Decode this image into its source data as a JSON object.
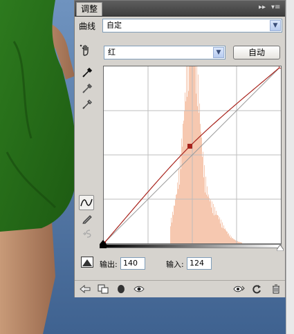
{
  "panel": {
    "tab_label": "调整",
    "menu_glyph": "▸▸|▾≡"
  },
  "curves": {
    "preset_label": "曲线",
    "preset_value": "自定",
    "channel_value": "红",
    "auto_button": "自动"
  },
  "io": {
    "output_label": "输出:",
    "output_value": "140",
    "input_label": "输入:",
    "input_value": "124"
  },
  "icons": {
    "hand": "hand-adjust-icon",
    "black_eyedropper": "eyedropper-black-icon",
    "gray_eyedropper": "eyedropper-gray-icon",
    "white_eyedropper": "eyedropper-white-icon",
    "curve_tool": "curve-tool-icon",
    "pencil_tool": "pencil-tool-icon",
    "smooth_tool": "smooth-icon",
    "clipping": "clipping-warning-icon"
  },
  "colors": {
    "curve": "#a8231c",
    "histogram": "#f6c8b0",
    "accent": "#7f9db9"
  },
  "chart_data": {
    "type": "line",
    "title": "",
    "xlim": [
      0,
      255
    ],
    "ylim": [
      0,
      255
    ],
    "grid": "4x4",
    "curve_points": [
      [
        0,
        0
      ],
      [
        124,
        140
      ],
      [
        255,
        255
      ]
    ]
  }
}
